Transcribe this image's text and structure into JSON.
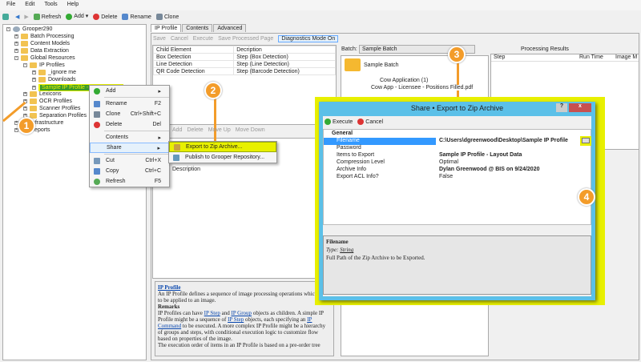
{
  "menu": [
    "File",
    "Edit",
    "Tools",
    "Help"
  ],
  "toolbar": {
    "refresh": "Refresh",
    "add": "Add",
    "delete": "Delete",
    "rename": "Rename",
    "clone": "Clone"
  },
  "tree": [
    "Grooper290",
    "Batch Processing",
    "Content Models",
    "Data Extraction",
    "Global Resources",
    "IP Profiles",
    "_ignore me",
    "Downloads",
    "Sample IP Profile - Layout Data",
    "Lexicons",
    "OCR Profiles",
    "Scanner Profiles",
    "Separation Profiles",
    "Infrastructure",
    "Reports"
  ],
  "tabs": [
    "IP Profile",
    "Contents",
    "Advanced"
  ],
  "editor_toolbar": {
    "save": "Save",
    "cancel": "Cancel",
    "execute": "Execute",
    "save_page": "Save Processed Page",
    "diag": "Diagnostics Mode On"
  },
  "grid": {
    "headers": [
      "Child Element",
      "Decription"
    ],
    "rows": [
      [
        "Box Detection",
        "Step (Box Detection)"
      ],
      [
        "Line Detection",
        "Step (Line Detection)"
      ],
      [
        "QR Code Detection",
        "Step (Barcode Detection)"
      ]
    ]
  },
  "lower_toolbar": {
    "add": "Add",
    "delete": "Delete",
    "move_up": "Move Up",
    "move_down": "Move Down"
  },
  "description_label": "Description",
  "context_menu": {
    "items": [
      {
        "label": "Add",
        "key": ""
      },
      {
        "label": "Rename",
        "key": "F2"
      },
      {
        "label": "Clone",
        "key": "Ctrl+Shift+C"
      },
      {
        "label": "Delete",
        "key": "Del"
      },
      {
        "label": "Contents",
        "key": ""
      },
      {
        "label": "Share",
        "key": ""
      },
      {
        "label": "Cut",
        "key": "Ctrl+X"
      },
      {
        "label": "Copy",
        "key": "Ctrl+C"
      },
      {
        "label": "Refresh",
        "key": "F5"
      }
    ]
  },
  "submenu": [
    "Export to Zip Archive...",
    "Publish to Grooper Repository..."
  ],
  "batch": {
    "label": "Batch:",
    "value": "Sample Batch",
    "folder": "Sample Batch",
    "child": "Cow Application (1)",
    "file": "Cow App - Licensee - Positions Filled.pdf"
  },
  "results": {
    "title": "Processing Results",
    "headers": [
      "Step",
      "Run Time",
      "Image M"
    ]
  },
  "help": {
    "title": "IP Profile",
    "intro": "An IP Profile defines a sequence of image processing operations which are to be applied to an image.",
    "remarks": "Remarks",
    "p1a": "IP Profiles can have ",
    "l1": "IP Step",
    "p1b": " and ",
    "l2": "IP Group",
    "p1c": " objects as children. A simple IP Profile might be a sequence of ",
    "l3": "IP Step",
    "p1d": " objects, each specifying an ",
    "l4": "IP Command",
    "p1e": " to be executed. A more complex IP Profile might be a hierarchy of groups and steps, with conditional execution logic to customize flow based on properties of the image.",
    "p2": "The execution order of items in an IP Profile is based on a pre-order tree"
  },
  "dialog": {
    "title": "Share • Export to Zip Archive",
    "help_btn": "?",
    "close_btn": "x",
    "execute": "Execute",
    "cancel": "Cancel",
    "category": "General",
    "props": [
      [
        "Filename",
        "C:\\Users\\dgreenwood\\Desktop\\Sample IP Profile"
      ],
      [
        "Password",
        ""
      ],
      [
        "Items to Export",
        "Sample IP Profile - Layout Data"
      ],
      [
        "Compression Level",
        "Optimal"
      ],
      [
        "Archive Info",
        "Dylan Greenwood @ BIS on 9/24/2020"
      ],
      [
        "Export ACL Info?",
        "False"
      ]
    ],
    "help_title": "Filename",
    "help_type_label": "Type:",
    "help_type": "String",
    "help_desc": "Full Path of the Zip Archive to be Exported."
  },
  "badges": [
    "1",
    "2",
    "3",
    "4"
  ],
  "colors": {
    "accent": "#f39c2a",
    "highlight": "#e8f000",
    "dialog_border": "#5bc0e8",
    "selection": "#3399ff"
  }
}
